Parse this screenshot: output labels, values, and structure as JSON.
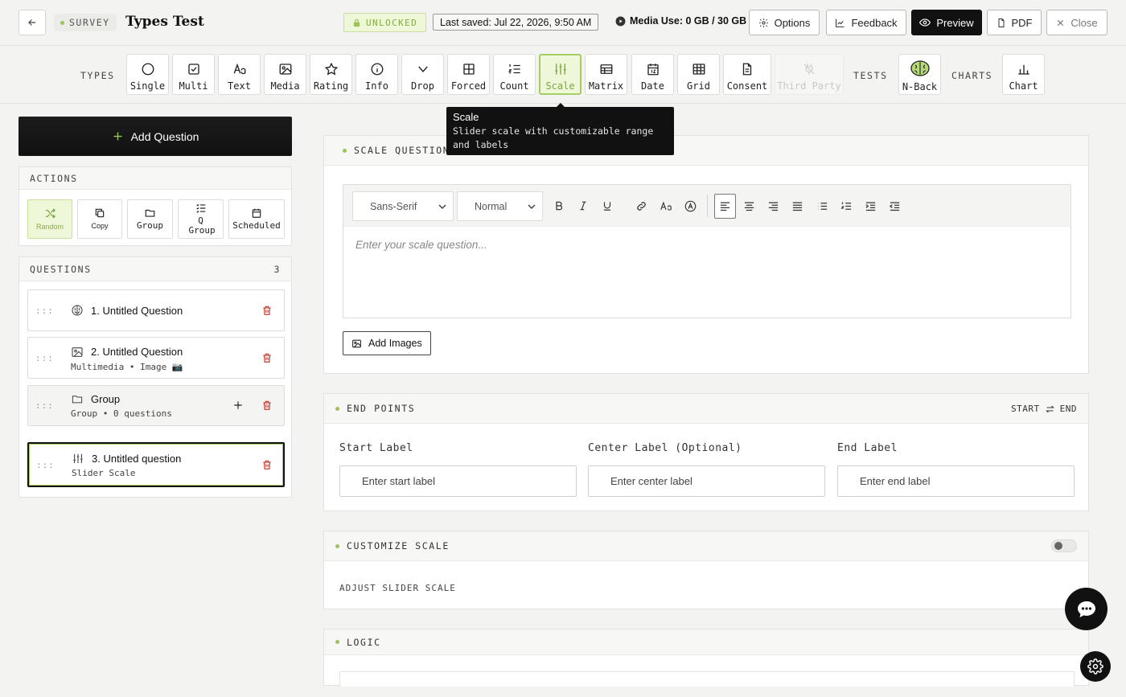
{
  "header": {
    "survey_badge": "SURVEY",
    "title": "Types Test",
    "lock_status": "UNLOCKED",
    "last_saved": "Last saved: Jul 22, 2026, 9:50 AM",
    "media_use": "Media Use: 0 GB / 30 GB",
    "buttons": {
      "options": "Options",
      "feedback": "Feedback",
      "preview": "Preview",
      "pdf": "PDF",
      "close": "Close"
    }
  },
  "toolbar": {
    "types_label": "TYPES",
    "types": [
      {
        "label": "Single",
        "icon": "circle-icon"
      },
      {
        "label": "Multi",
        "icon": "checkbox-icon"
      },
      {
        "label": "Text",
        "icon": "text-aa-icon"
      },
      {
        "label": "Media",
        "icon": "image-icon"
      },
      {
        "label": "Rating",
        "icon": "star-icon"
      },
      {
        "label": "Info",
        "icon": "info-icon"
      },
      {
        "label": "Drop",
        "icon": "chevron-down-icon"
      },
      {
        "label": "Forced",
        "icon": "grid-icon"
      },
      {
        "label": "Count",
        "icon": "numbered-list-icon"
      },
      {
        "label": "Scale",
        "icon": "sliders-icon"
      },
      {
        "label": "Matrix",
        "icon": "matrix-icon"
      },
      {
        "label": "Date",
        "icon": "calendar-icon"
      },
      {
        "label": "Grid",
        "icon": "table-icon"
      },
      {
        "label": "Consent",
        "icon": "document-icon"
      },
      {
        "label": "Third Party",
        "icon": "plug-icon"
      }
    ],
    "tests_label": "TESTS",
    "tests": [
      {
        "label": "N-Back",
        "icon": "brain-icon"
      }
    ],
    "charts_label": "CHARTS",
    "charts": [
      {
        "label": "Chart",
        "icon": "bar-chart-icon"
      }
    ],
    "active": "Scale"
  },
  "tooltip": {
    "title": "Scale",
    "description": "Slider scale with customizable range and labels"
  },
  "sidebar": {
    "add_question": "Add Question",
    "actions_label": "ACTIONS",
    "actions": [
      {
        "label": "Random",
        "icon": "shuffle-icon"
      },
      {
        "label": "Copy",
        "icon": "copy-icon"
      },
      {
        "label": "Group",
        "icon": "folder-icon"
      },
      {
        "label": "Q Group",
        "icon": "list-check-icon"
      },
      {
        "label": "Scheduled",
        "icon": "calendar-icon"
      }
    ],
    "questions_label": "QUESTIONS",
    "questions_count": "3",
    "questions": [
      {
        "title": "1. Untitled Question",
        "subtitle": "",
        "icon": "brain-icon"
      },
      {
        "title": "2. Untitled Question",
        "subtitle": "Multimedia • Image 📷",
        "icon": "image-icon"
      },
      {
        "title": "Group",
        "subtitle": "Group • 0 questions",
        "icon": "folder-icon"
      },
      {
        "title": "3. Untitled question",
        "subtitle": "Slider Scale",
        "icon": "sliders-icon"
      }
    ],
    "drag_glyph": ":::"
  },
  "main": {
    "scale_card": {
      "title": "SCALE QUESTION",
      "font_family": "Sans-Serif",
      "font_size": "Normal",
      "placeholder": "Enter your scale question...",
      "add_images": "Add Images"
    },
    "endpoints_card": {
      "title": "END POINTS",
      "swap_start": "START",
      "swap_end": "END",
      "start_label": "Start Label",
      "center_label": "Center Label (Optional)",
      "end_label": "End Label",
      "start_placeholder": "Enter start label",
      "center_placeholder": "Enter center label",
      "end_placeholder": "Enter end label"
    },
    "customize_card": {
      "title": "CUSTOMIZE SCALE",
      "adjust": "ADJUST SLIDER SCALE"
    },
    "logic_card": {
      "title": "LOGIC"
    }
  },
  "colors": {
    "accent": "#a7cc62",
    "accent_bg": "#eef7d8",
    "danger": "#c0392b",
    "dark": "#111111"
  }
}
